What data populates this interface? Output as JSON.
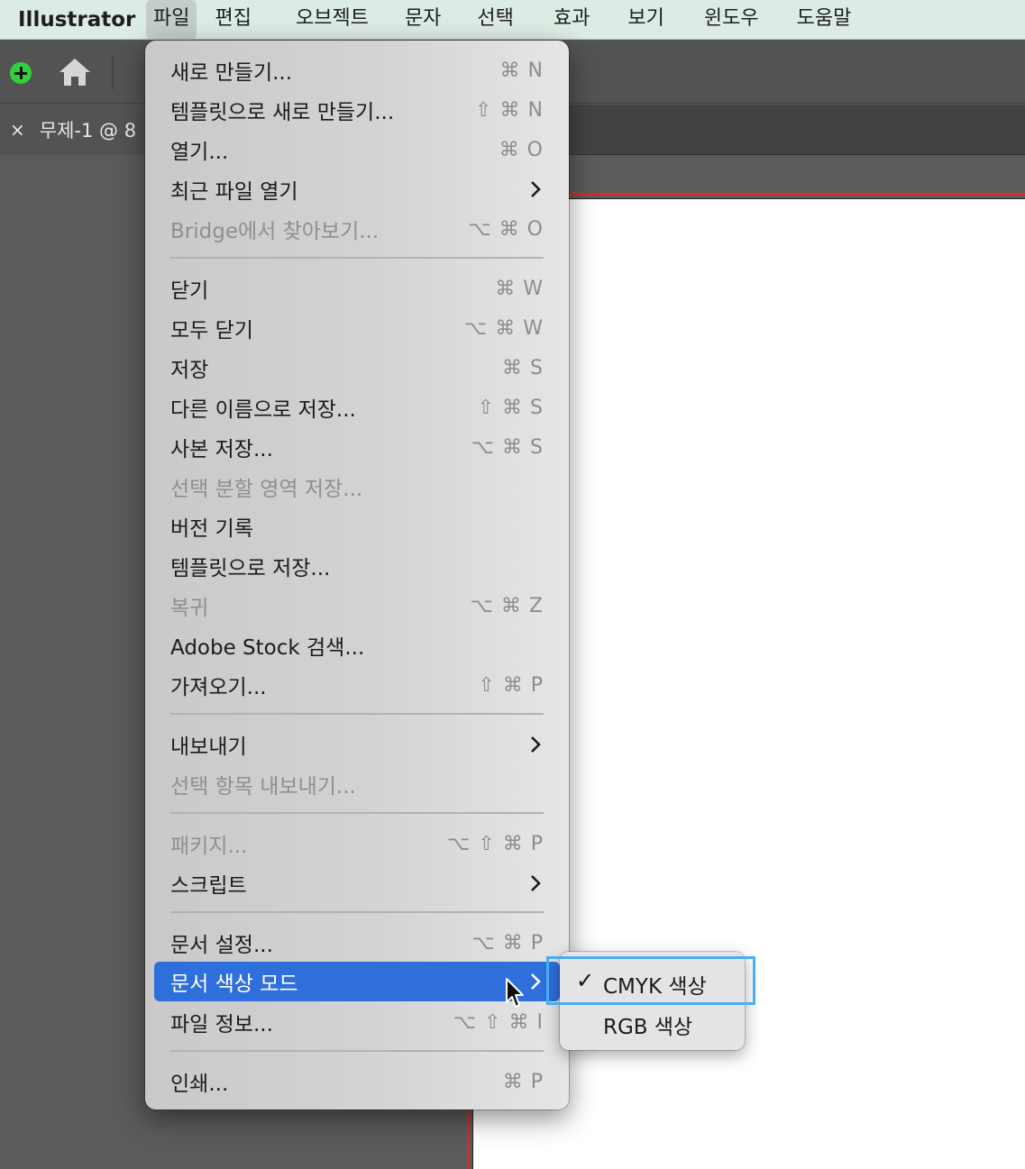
{
  "menubar": {
    "app_name": "Illustrator",
    "items": [
      "파일",
      "편집",
      "오브젝트",
      "문자",
      "선택",
      "효과",
      "보기",
      "윈도우",
      "도움말"
    ],
    "active_index": 0
  },
  "document_tab": {
    "close_glyph": "×",
    "title": "무제-1 @ 8"
  },
  "icons": {
    "new_file": "plus-icon",
    "home": "home-icon",
    "cursor": "arrow-cursor-icon"
  },
  "colors": {
    "highlight": "#2f6fdc",
    "artboard_border": "#d92b2b",
    "plus_green": "#2fd23a",
    "focus_outline": "#4aaef0"
  },
  "file_menu": {
    "items": [
      {
        "label": "새로 만들기...",
        "shortcut": "⌘ N"
      },
      {
        "label": "템플릿으로 새로 만들기...",
        "shortcut": "⇧ ⌘ N"
      },
      {
        "label": "열기...",
        "shortcut": "⌘ O"
      },
      {
        "label": "최근 파일 열기",
        "shortcut": "",
        "submenu": true
      },
      {
        "label": "Bridge에서 찾아보기...",
        "shortcut": "⌥ ⌘ O",
        "disabled": true
      },
      {
        "label": "닫기",
        "shortcut": "⌘ W"
      },
      {
        "label": "모두 닫기",
        "shortcut": "⌥ ⌘ W"
      },
      {
        "label": "저장",
        "shortcut": "⌘ S"
      },
      {
        "label": "다른 이름으로 저장...",
        "shortcut": "⇧ ⌘ S"
      },
      {
        "label": "사본 저장...",
        "shortcut": "⌥ ⌘ S"
      },
      {
        "label": "선택 분할 영역 저장...",
        "shortcut": "",
        "disabled": true
      },
      {
        "label": "버전 기록",
        "shortcut": ""
      },
      {
        "label": "템플릿으로 저장...",
        "shortcut": ""
      },
      {
        "label": "복귀",
        "shortcut": "⌥ ⌘ Z",
        "disabled": true
      },
      {
        "label": "Adobe Stock 검색...",
        "shortcut": ""
      },
      {
        "label": "가져오기...",
        "shortcut": "⇧ ⌘ P"
      },
      {
        "label": "내보내기",
        "shortcut": "",
        "submenu": true
      },
      {
        "label": "선택 항목 내보내기...",
        "shortcut": "",
        "disabled": true
      },
      {
        "label": "패키지...",
        "shortcut": "⌥ ⇧ ⌘ P",
        "disabled": true
      },
      {
        "label": "스크립트",
        "shortcut": "",
        "submenu": true
      },
      {
        "label": "문서 설정...",
        "shortcut": "⌥ ⌘ P"
      },
      {
        "label": "문서 색상 모드",
        "shortcut": "",
        "submenu": true,
        "highlighted": true
      },
      {
        "label": "파일 정보...",
        "shortcut": "⌥ ⇧ ⌘ I"
      },
      {
        "label": "인쇄...",
        "shortcut": "⌘ P"
      }
    ]
  },
  "color_mode_submenu": {
    "items": [
      {
        "label": "CMYK 색상",
        "checked": true,
        "check_glyph": "✓"
      },
      {
        "label": "RGB 색상",
        "checked": false
      }
    ]
  }
}
